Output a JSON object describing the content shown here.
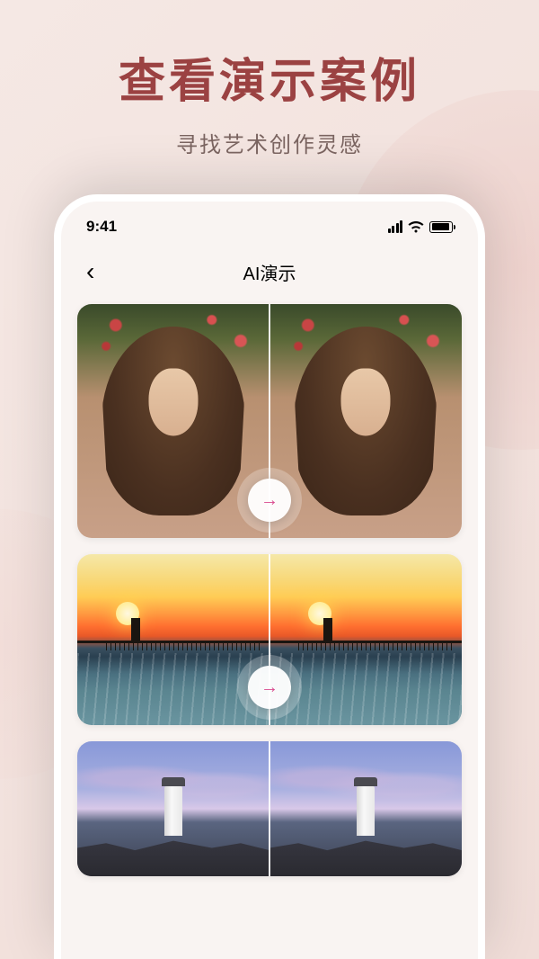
{
  "header": {
    "headline": "查看演示案例",
    "subtitle": "寻找艺术创作灵感"
  },
  "statusBar": {
    "time": "9:41"
  },
  "navBar": {
    "title": "AI演示",
    "backGlyph": "‹"
  },
  "slider": {
    "arrowGlyph": "→"
  }
}
